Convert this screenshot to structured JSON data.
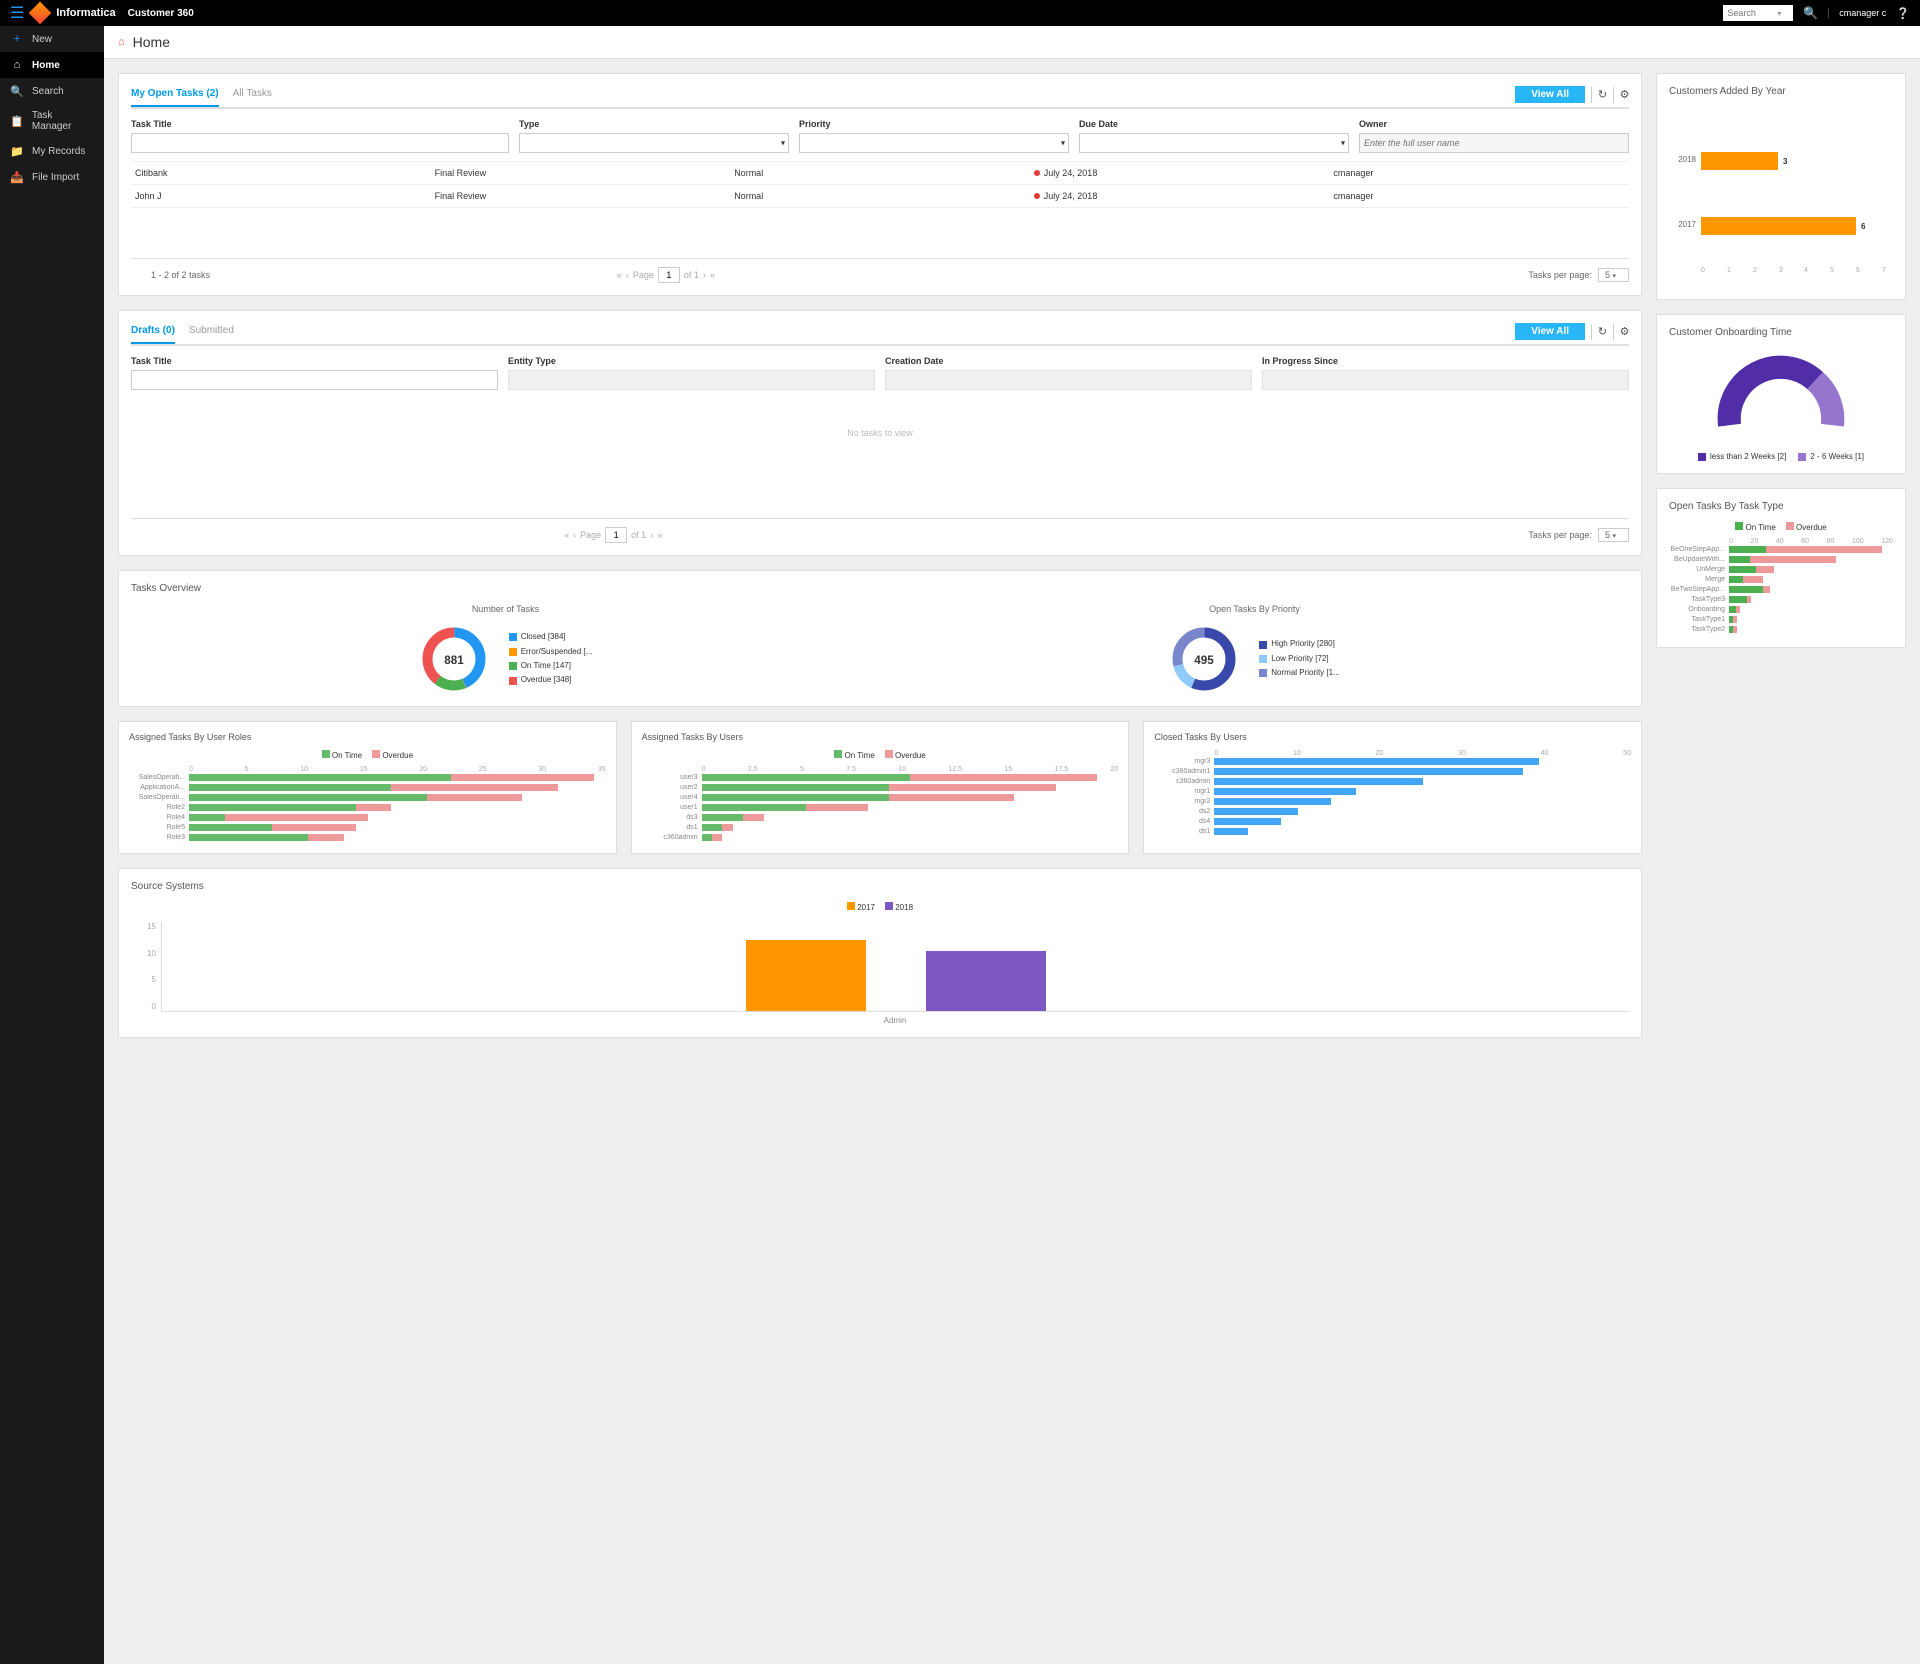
{
  "topbar": {
    "brand": "Informatica",
    "app_name": "Customer 360",
    "search_placeholder": "Search",
    "user": "cmanager c"
  },
  "sidebar": {
    "items": [
      {
        "label": "New"
      },
      {
        "label": "Home"
      },
      {
        "label": "Search"
      },
      {
        "label": "Task Manager"
      },
      {
        "label": "My Records"
      },
      {
        "label": "File Import"
      }
    ]
  },
  "page_title": "Home",
  "tasks_panel": {
    "tabs": [
      {
        "label": "My Open Tasks (2)",
        "active": true
      },
      {
        "label": "All Tasks",
        "active": false
      }
    ],
    "view_all": "View All",
    "columns": {
      "title": "Task Title",
      "type": "Type",
      "priority": "Priority",
      "due": "Due Date",
      "owner": "Owner"
    },
    "owner_placeholder": "Enter the full user name",
    "rows": [
      {
        "title": "Citibank",
        "type": "Final Review",
        "priority": "Normal",
        "due": "July 24, 2018",
        "owner": "cmanager"
      },
      {
        "title": "John J",
        "type": "Final Review",
        "priority": "Normal",
        "due": "July 24, 2018",
        "owner": "cmanager"
      }
    ],
    "footer": {
      "count": "1 - 2 of 2 tasks",
      "page_label": "Page",
      "page_value": "1",
      "of_label": "of 1",
      "per_page_label": "Tasks per page:",
      "per_page_value": "5"
    }
  },
  "drafts_panel": {
    "tabs": [
      {
        "label": "Drafts (0)",
        "active": true
      },
      {
        "label": "Submitted",
        "active": false
      }
    ],
    "view_all": "View All",
    "columns": {
      "title": "Task Title",
      "entity": "Entity Type",
      "creation": "Creation Date",
      "progress": "In Progress Since"
    },
    "empty": "No tasks to view",
    "footer": {
      "page_label": "Page",
      "page_value": "1",
      "of_label": "of 1",
      "per_page_label": "Tasks per page:",
      "per_page_value": "5"
    }
  },
  "overview": {
    "title": "Tasks Overview",
    "number_of_tasks": {
      "title": "Number of Tasks",
      "center": "881",
      "legend": [
        {
          "label": "Closed [384]",
          "color": "#2196f3"
        },
        {
          "label": "Error/Suspended [...",
          "color": "#ff9800"
        },
        {
          "label": "On Time [147]",
          "color": "#4caf50"
        },
        {
          "label": "Overdue [348]",
          "color": "#ef5350"
        }
      ]
    },
    "open_by_priority": {
      "title": "Open Tasks By Priority",
      "center": "495",
      "legend": [
        {
          "label": "High Priority [280]",
          "color": "#3949ab"
        },
        {
          "label": "Low Priority [72]",
          "color": "#90caf9"
        },
        {
          "label": "Normal Priority [1...",
          "color": "#7986cb"
        }
      ]
    }
  },
  "assigned_roles": {
    "title": "Assigned Tasks By User Roles",
    "legend": {
      "ontime": "On Time",
      "overdue": "Overdue"
    }
  },
  "assigned_users": {
    "title": "Assigned Tasks By Users",
    "legend": {
      "ontime": "On Time",
      "overdue": "Overdue"
    }
  },
  "closed_users": {
    "title": "Closed Tasks By Users"
  },
  "source_systems": {
    "title": "Source Systems",
    "legend": {
      "a": "2017",
      "b": "2018"
    },
    "xlabel": "Admin"
  },
  "customers_added": {
    "title": "Customers Added By Year"
  },
  "onboarding": {
    "title": "Customer Onboarding Time",
    "legend": [
      {
        "label": "less than 2 Weeks [2]",
        "color": "#512da8"
      },
      {
        "label": "2 - 6 Weeks [1]",
        "color": "#9575cd"
      }
    ]
  },
  "open_by_type": {
    "title": "Open Tasks By Task Type",
    "legend": {
      "ontime": "On Time",
      "overdue": "Overdue"
    }
  },
  "chart_data": {
    "customers_added_by_year": {
      "type": "bar",
      "orientation": "horizontal",
      "categories": [
        "2018",
        "2017"
      ],
      "values": [
        3,
        6
      ],
      "xlim": [
        0,
        7
      ]
    },
    "customer_onboarding_time": {
      "type": "pie",
      "style": "half-donut",
      "slices": [
        {
          "label": "less than 2 Weeks",
          "value": 2,
          "color": "#512da8"
        },
        {
          "label": "2 - 6 Weeks",
          "value": 1,
          "color": "#9575cd"
        }
      ]
    },
    "open_tasks_by_task_type": {
      "type": "bar",
      "orientation": "horizontal",
      "stacked": true,
      "categories": [
        "BeOneStepApp...",
        "BeUpdateWith...",
        "UnMerge",
        "Merge",
        "BeTwoStepApp...",
        "TaskType3",
        "Onboarding",
        "TaskType1",
        "TaskType2"
      ],
      "series": [
        {
          "name": "On Time",
          "color": "#4caf50",
          "values": [
            27,
            15,
            20,
            10,
            25,
            13,
            5,
            3,
            3
          ]
        },
        {
          "name": "Overdue",
          "color": "#ef9a9a",
          "values": [
            85,
            63,
            13,
            15,
            5,
            3,
            3,
            3,
            3
          ]
        }
      ],
      "xlim": [
        0,
        120
      ]
    },
    "number_of_tasks": {
      "type": "pie",
      "style": "donut",
      "total": 881,
      "slices": [
        {
          "label": "Closed",
          "value": 384,
          "color": "#2196f3"
        },
        {
          "label": "Error/Suspended",
          "value": 2,
          "color": "#ff9800"
        },
        {
          "label": "On Time",
          "value": 147,
          "color": "#4caf50"
        },
        {
          "label": "Overdue",
          "value": 348,
          "color": "#ef5350"
        }
      ]
    },
    "open_tasks_by_priority": {
      "type": "pie",
      "style": "donut",
      "total": 495,
      "slices": [
        {
          "label": "High Priority",
          "value": 280,
          "color": "#3949ab"
        },
        {
          "label": "Low Priority",
          "value": 72,
          "color": "#90caf9"
        },
        {
          "label": "Normal Priority",
          "value": 143,
          "color": "#7986cb"
        }
      ]
    },
    "assigned_tasks_by_user_roles": {
      "type": "bar",
      "orientation": "horizontal",
      "stacked": true,
      "categories": [
        "SalesOperati...",
        "ApplicationA...",
        "SalesOperati...",
        "Role2",
        "Role4",
        "Role5",
        "Role3"
      ],
      "series": [
        {
          "name": "On Time",
          "color": "#66bb6a",
          "values": [
            22,
            17,
            20,
            14,
            3,
            7,
            10
          ]
        },
        {
          "name": "Overdue",
          "color": "#ef9a9a",
          "values": [
            12,
            14,
            8,
            3,
            12,
            7,
            3
          ]
        }
      ],
      "xlim": [
        0,
        35
      ]
    },
    "assigned_tasks_by_users": {
      "type": "bar",
      "orientation": "horizontal",
      "stacked": true,
      "categories": [
        "user3",
        "user2",
        "user4",
        "user1",
        "ds3",
        "ds1",
        "c360admin"
      ],
      "series": [
        {
          "name": "On Time",
          "color": "#66bb6a",
          "values": [
            10,
            9,
            9,
            5,
            2,
            1,
            0.5
          ]
        },
        {
          "name": "Overdue",
          "color": "#ef9a9a",
          "values": [
            9,
            8,
            6,
            3,
            1,
            0.5,
            0.5
          ]
        }
      ],
      "xlim": [
        0,
        20
      ]
    },
    "closed_tasks_by_users": {
      "type": "bar",
      "orientation": "horizontal",
      "categories": [
        "mgr3",
        "c360admin1",
        "c360admin",
        "mgr1",
        "mgr2",
        "ds2",
        "ds4",
        "ds1"
      ],
      "values": [
        39,
        37,
        25,
        17,
        14,
        10,
        8,
        4
      ],
      "xlim": [
        0,
        50
      ],
      "color": "#42a5f5"
    },
    "source_systems": {
      "type": "bar",
      "categories": [
        "Admin"
      ],
      "series": [
        {
          "name": "2017",
          "color": "#ff9800",
          "values": [
            12
          ]
        },
        {
          "name": "2018",
          "color": "#7e57c2",
          "values": [
            10
          ]
        }
      ],
      "ylim": [
        0,
        15
      ]
    }
  }
}
